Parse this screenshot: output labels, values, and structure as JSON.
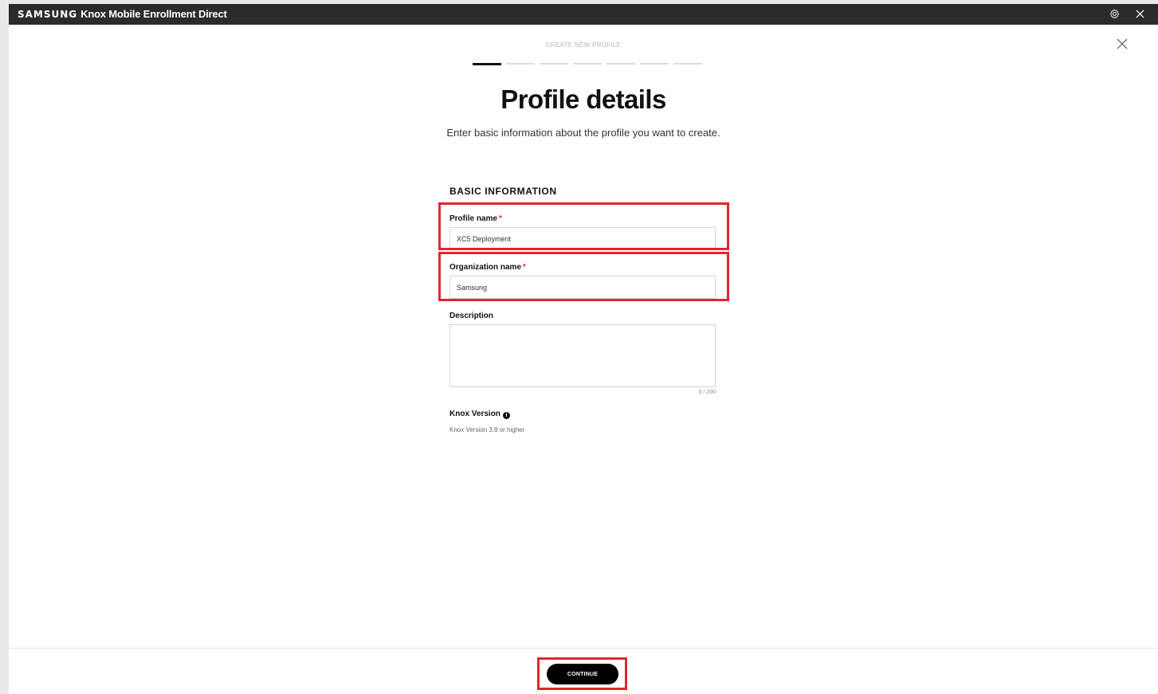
{
  "titlebar": {
    "brand_logo": "SAMSUNG",
    "app_name": "Knox Mobile Enrollment Direct",
    "settings_icon": "gear-icon",
    "close_icon": "close-icon"
  },
  "wizard": {
    "step_label": "CREATE NEW PROFILE",
    "steps_total": 7,
    "current_step": 1,
    "title": "Profile details",
    "subtitle": "Enter basic information about the profile you want to create."
  },
  "form": {
    "section_title": "BASIC INFORMATION",
    "profile_name": {
      "label": "Profile name",
      "required_mark": "*",
      "value": "XC5 Deployment"
    },
    "organization_name": {
      "label": "Organization name",
      "required_mark": "*",
      "value": "Samsung"
    },
    "description": {
      "label": "Description",
      "value": "",
      "counter": "0 / 200"
    },
    "knox_version": {
      "label": "Knox Version",
      "info_icon": "info-icon",
      "info_glyph": "i",
      "value": "Knox Version 3.8 or higher"
    }
  },
  "footer": {
    "continue_label": "CONTINUE"
  },
  "colors": {
    "titlebar_bg": "#2b2b2b",
    "highlight": "#e0262d",
    "button_bg": "#000000"
  }
}
